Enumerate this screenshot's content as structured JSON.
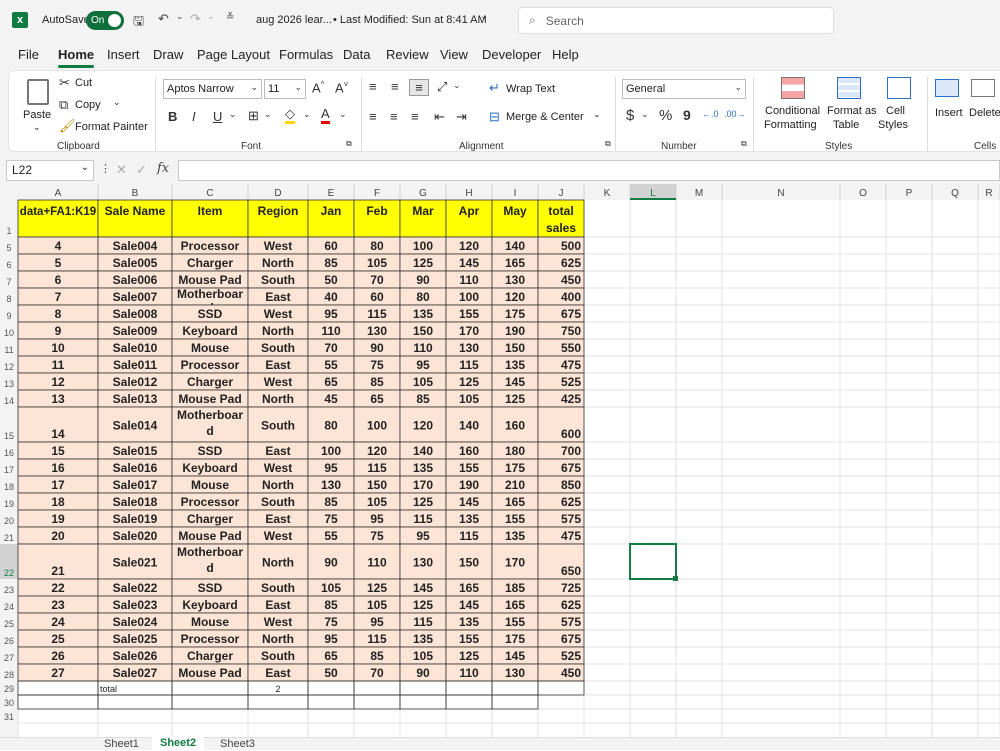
{
  "title_bar": {
    "autosave_label": "AutoSave",
    "toggle_label": "On",
    "file_name": "aug 2026 lear...",
    "modified": "• Last Modified: Sun at 8:41 AM",
    "search_placeholder": "Search"
  },
  "menu_tabs": [
    "File",
    "Home",
    "Insert",
    "Draw",
    "Page Layout",
    "Formulas",
    "Data",
    "Review",
    "View",
    "Developer",
    "Help"
  ],
  "active_tab": "Home",
  "ribbon": {
    "clipboard": {
      "paste": "Paste",
      "cut": "Cut",
      "copy": "Copy",
      "format_painter": "Format Painter",
      "label": "Clipboard"
    },
    "font": {
      "name": "Aptos Narrow",
      "size": "11",
      "label": "Font",
      "grow": "A^",
      "shrink": "A˅"
    },
    "alignment": {
      "wrap": "Wrap Text",
      "merge": "Merge & Center",
      "label": "Alignment"
    },
    "number": {
      "format": "General",
      "label": "Number",
      "currency": "$",
      "percent": "%",
      "comma": "9"
    },
    "styles": {
      "conditional": "Conditional",
      "conditional2": "Formatting",
      "format_as": "Format as",
      "format_as2": "Table",
      "cell": "Cell",
      "cell2": "Styles",
      "label": "Styles"
    },
    "cells": {
      "insert": "Insert",
      "delete": "Delete",
      "label": "Cells"
    }
  },
  "formula_bar": {
    "name_box": "L22",
    "formula": ""
  },
  "columns": [
    "A",
    "B",
    "C",
    "D",
    "E",
    "F",
    "G",
    "H",
    "I",
    "J",
    "K",
    "L",
    "M",
    "N",
    "O",
    "P",
    "Q",
    "R"
  ],
  "header_row": {
    "num": "1",
    "cells": [
      "data+FA1:K19",
      "Sale Name",
      "Item",
      "Region",
      "Jan",
      "Feb",
      "Mar",
      "Apr",
      "May",
      "total sales"
    ]
  },
  "rows": [
    {
      "num": "5",
      "cells": [
        "4",
        "Sale004",
        "Processor",
        "West",
        "60",
        "80",
        "100",
        "120",
        "140",
        "500"
      ]
    },
    {
      "num": "6",
      "cells": [
        "5",
        "Sale005",
        "Charger",
        "North",
        "85",
        "105",
        "125",
        "145",
        "165",
        "625"
      ]
    },
    {
      "num": "7",
      "cells": [
        "6",
        "Sale006",
        "Mouse Pad",
        "South",
        "50",
        "70",
        "90",
        "110",
        "130",
        "450"
      ]
    },
    {
      "num": "8",
      "cells": [
        "7",
        "Sale007",
        "Motherboard",
        "East",
        "40",
        "60",
        "80",
        "100",
        "120",
        "400"
      ]
    },
    {
      "num": "9",
      "cells": [
        "8",
        "Sale008",
        "SSD",
        "West",
        "95",
        "115",
        "135",
        "155",
        "175",
        "675"
      ]
    },
    {
      "num": "10",
      "cells": [
        "9",
        "Sale009",
        "Keyboard",
        "North",
        "110",
        "130",
        "150",
        "170",
        "190",
        "750"
      ]
    },
    {
      "num": "11",
      "cells": [
        "10",
        "Sale010",
        "Mouse",
        "South",
        "70",
        "90",
        "110",
        "130",
        "150",
        "550"
      ]
    },
    {
      "num": "12",
      "cells": [
        "11",
        "Sale011",
        "Processor",
        "East",
        "55",
        "75",
        "95",
        "115",
        "135",
        "475"
      ]
    },
    {
      "num": "13",
      "cells": [
        "12",
        "Sale012",
        "Charger",
        "West",
        "65",
        "85",
        "105",
        "125",
        "145",
        "525"
      ]
    },
    {
      "num": "14",
      "cells": [
        "13",
        "Sale013",
        "Mouse Pad",
        "North",
        "45",
        "65",
        "85",
        "105",
        "125",
        "425"
      ]
    },
    {
      "num": "15",
      "cells": [
        "14",
        "Sale014",
        "Motherboard",
        "South",
        "80",
        "100",
        "120",
        "140",
        "160",
        "600"
      ]
    },
    {
      "num": "16",
      "cells": [
        "15",
        "Sale015",
        "SSD",
        "East",
        "100",
        "120",
        "140",
        "160",
        "180",
        "700"
      ]
    },
    {
      "num": "17",
      "cells": [
        "16",
        "Sale016",
        "Keyboard",
        "West",
        "95",
        "115",
        "135",
        "155",
        "175",
        "675"
      ]
    },
    {
      "num": "18",
      "cells": [
        "17",
        "Sale017",
        "Mouse",
        "North",
        "130",
        "150",
        "170",
        "190",
        "210",
        "850"
      ]
    },
    {
      "num": "19",
      "cells": [
        "18",
        "Sale018",
        "Processor",
        "South",
        "85",
        "105",
        "125",
        "145",
        "165",
        "625"
      ]
    },
    {
      "num": "20",
      "cells": [
        "19",
        "Sale019",
        "Charger",
        "East",
        "75",
        "95",
        "115",
        "135",
        "155",
        "575"
      ]
    },
    {
      "num": "21",
      "cells": [
        "20",
        "Sale020",
        "Mouse Pad",
        "West",
        "55",
        "75",
        "95",
        "115",
        "135",
        "475"
      ]
    },
    {
      "num": "22",
      "cells": [
        "21",
        "Sale021",
        "Motherboard",
        "North",
        "90",
        "110",
        "130",
        "150",
        "170",
        "650"
      ]
    },
    {
      "num": "23",
      "cells": [
        "22",
        "Sale022",
        "SSD",
        "South",
        "105",
        "125",
        "145",
        "165",
        "185",
        "725"
      ]
    },
    {
      "num": "24",
      "cells": [
        "23",
        "Sale023",
        "Keyboard",
        "East",
        "85",
        "105",
        "125",
        "145",
        "165",
        "625"
      ]
    },
    {
      "num": "25",
      "cells": [
        "24",
        "Sale024",
        "Mouse",
        "West",
        "75",
        "95",
        "115",
        "135",
        "155",
        "575"
      ]
    },
    {
      "num": "26",
      "cells": [
        "25",
        "Sale025",
        "Processor",
        "North",
        "95",
        "115",
        "135",
        "155",
        "175",
        "675"
      ]
    },
    {
      "num": "27",
      "cells": [
        "26",
        "Sale026",
        "Charger",
        "South",
        "65",
        "85",
        "105",
        "125",
        "145",
        "525"
      ]
    },
    {
      "num": "28",
      "cells": [
        "27",
        "Sale027",
        "Mouse Pad",
        "East",
        "50",
        "70",
        "90",
        "110",
        "130",
        "450"
      ]
    }
  ],
  "total_row": {
    "num": "29",
    "label": "total",
    "value": "2"
  },
  "empty_rows": [
    "30",
    "31"
  ],
  "sheet_tabs": [
    "Sheet1",
    "Sheet2",
    "Sheet3"
  ],
  "active_sheet": "Sheet2",
  "colors": {
    "header_fill": "#ffff00",
    "data_fill": "#fce4d6",
    "accent": "#107c41",
    "gridline": "#e1e1e1"
  }
}
